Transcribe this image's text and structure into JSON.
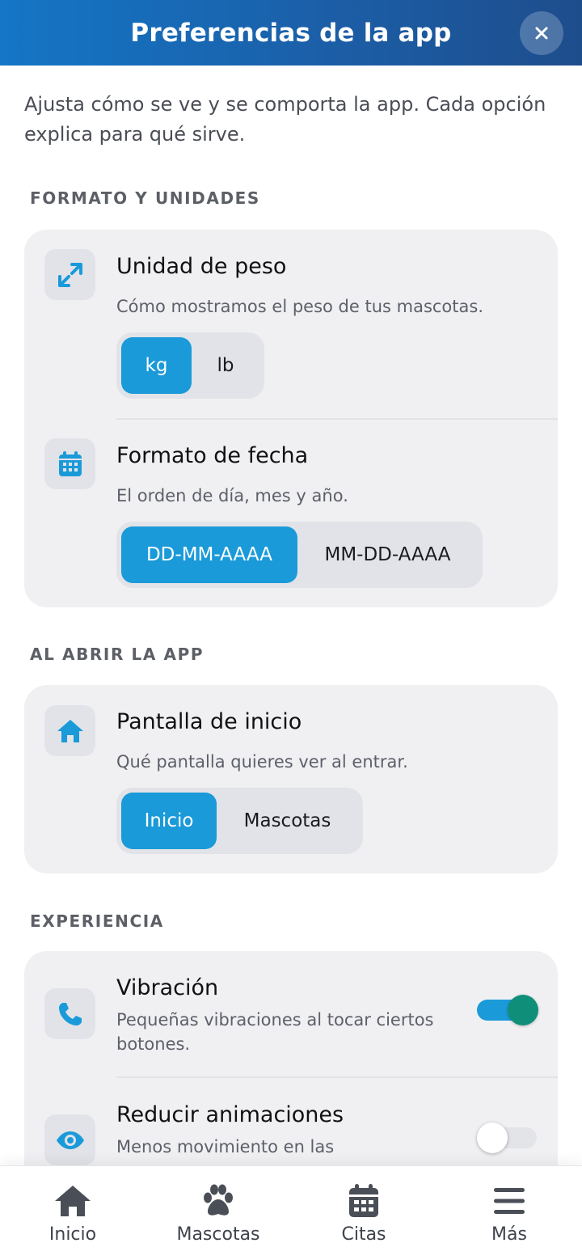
{
  "header": {
    "title": "Preferencias de la app",
    "close_label": "×"
  },
  "intro": "Ajusta cómo se ve y se comporta la app. Cada opción explica para qué sirve.",
  "sections": {
    "format": {
      "title": "FORMATO Y UNIDADES",
      "weight": {
        "icon": "resize-arrows-icon",
        "title": "Unidad de peso",
        "desc": "Cómo mostramos el peso de tus mascotas.",
        "options": [
          "kg",
          "lb"
        ],
        "selected": "kg"
      },
      "date": {
        "icon": "calendar-icon",
        "title": "Formato de fecha",
        "desc": "El orden de día, mes y año.",
        "options": [
          "DD-MM-AAAA",
          "MM-DD-AAAA"
        ],
        "selected": "DD-MM-AAAA"
      }
    },
    "open": {
      "title": "AL ABRIR LA APP",
      "home": {
        "icon": "home-icon",
        "title": "Pantalla de inicio",
        "desc": "Qué pantalla quieres ver al entrar.",
        "options": [
          "Inicio",
          "Mascotas"
        ],
        "selected": "Inicio"
      }
    },
    "experience": {
      "title": "EXPERIENCIA",
      "vibration": {
        "icon": "phone-icon",
        "title": "Vibración",
        "desc": "Pequeñas vibraciones al tocar ciertos botones.",
        "enabled": true
      },
      "animations": {
        "icon": "eye-icon",
        "title": "Reducir animaciones",
        "desc": "Menos movimiento en las",
        "enabled": false
      }
    }
  },
  "nav": [
    {
      "label": "Inicio",
      "icon": "home-icon"
    },
    {
      "label": "Mascotas",
      "icon": "paw-icon"
    },
    {
      "label": "Citas",
      "icon": "calendar-icon"
    },
    {
      "label": "Más",
      "icon": "menu-icon"
    }
  ],
  "colors": {
    "accent": "#1a9ad9",
    "header_start": "#1476c6",
    "header_end": "#1e4d8c",
    "toggle_on_knob": "#0f8f7a",
    "card_bg": "#f0f0f3"
  }
}
